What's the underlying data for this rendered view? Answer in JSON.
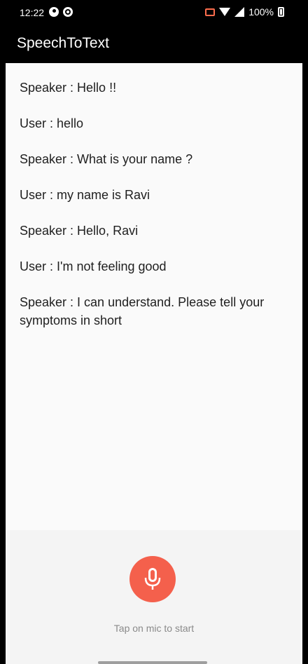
{
  "status_bar": {
    "time": "12:22",
    "battery": "100%",
    "icons": [
      "p-icon",
      "record-icon",
      "cast-icon",
      "wifi-icon",
      "signal-icon",
      "battery-icon"
    ]
  },
  "app_bar": {
    "title": "SpeechToText"
  },
  "conversation": [
    {
      "speaker": "Speaker",
      "text": "Speaker : Hello !!"
    },
    {
      "speaker": "User",
      "text": "User : hello"
    },
    {
      "speaker": "Speaker",
      "text": "Speaker : What is your name ?"
    },
    {
      "speaker": "User",
      "text": "User : my name is Ravi"
    },
    {
      "speaker": "Speaker",
      "text": "Speaker : Hello, Ravi"
    },
    {
      "speaker": "User",
      "text": "User : I'm not feeling good"
    },
    {
      "speaker": "Speaker",
      "text": "Speaker : I can understand. Please tell your symptoms in short"
    }
  ],
  "mic": {
    "icon": "microphone-icon",
    "hint": "Tap on mic to start",
    "color": "#f4604c"
  },
  "colors": {
    "app_bar": "#000000",
    "content_bg": "#fafafa",
    "panel_bg": "#f4f4f4",
    "accent": "#f4604c"
  }
}
